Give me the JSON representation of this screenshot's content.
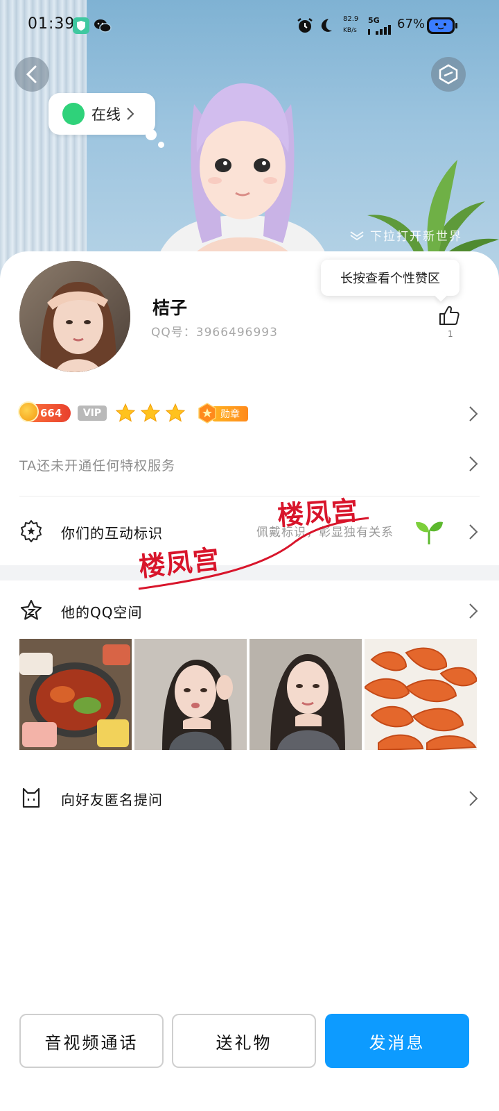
{
  "status_bar": {
    "time": "01:39",
    "net_speed_value": "82.9",
    "net_speed_unit": "KB/s",
    "network": "5G",
    "battery": "67%"
  },
  "hero": {
    "online_status": "在线",
    "pull_hint": "下拉打开新世界"
  },
  "profile": {
    "nickname": "桔子",
    "qq_number": "QQ号：3966496993",
    "like_tip": "长按查看个性赞区",
    "like_count": "1"
  },
  "badges": {
    "level": "664",
    "vip": "VIP",
    "medal": "勋章",
    "stars": 3
  },
  "privilege_text": "TA还未开通任何特权服务",
  "interaction": {
    "label": "你们的互动标识",
    "desc": "佩戴标识，彰显独有关系"
  },
  "qzone": {
    "label": "他的QQ空间"
  },
  "anonymous": {
    "label": "向好友匿名提问"
  },
  "watermark": {
    "text1": "楼凤宫",
    "text2": "楼凤宫"
  },
  "buttons": {
    "call": "音视频通话",
    "gift": "送礼物",
    "message": "发消息"
  },
  "colors": {
    "primary": "#0d9bff",
    "online": "#2fd27a",
    "watermark": "#d8152b"
  }
}
